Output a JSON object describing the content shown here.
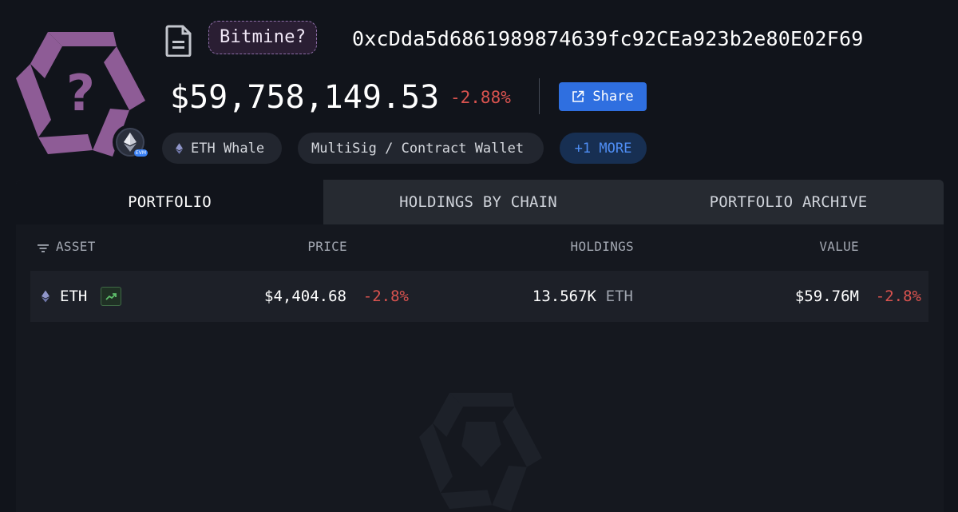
{
  "entity": {
    "name_tag": "Bitmine?",
    "address": "0xcDda5d6861989874639fc92CEa923b2e80E02F69",
    "balance": "$59,758,149.53",
    "balance_change": "-2.88%",
    "logo_icon": "unknown-entity-pentagon-icon",
    "chain_badge": {
      "icon": "ethereum-icon",
      "label": "EVM"
    },
    "colors": {
      "logo": "#8e5c96",
      "negative": "#d9534f",
      "accent": "#2f6fe0"
    }
  },
  "actions": {
    "share_label": "Share"
  },
  "tags": [
    {
      "label": "ETH Whale",
      "icon": "ethereum-icon"
    },
    {
      "label": "MultiSig / Contract Wallet"
    },
    {
      "label": "+1 MORE"
    }
  ],
  "tabs": [
    {
      "label": "PORTFOLIO",
      "active": true
    },
    {
      "label": "HOLDINGS BY CHAIN",
      "active": false
    },
    {
      "label": "PORTFOLIO ARCHIVE",
      "active": false
    }
  ],
  "table": {
    "columns": [
      "ASSET",
      "PRICE",
      "HOLDINGS",
      "VALUE"
    ],
    "rows": [
      {
        "asset": "ETH",
        "asset_icon": "ethereum-icon",
        "trend_icon": "trending-up-icon",
        "price": "$4,404.68",
        "price_change": "-2.8%",
        "holdings": "13.567K",
        "holdings_unit": "ETH",
        "value": "$59.76M",
        "value_change": "-2.8%"
      }
    ]
  }
}
